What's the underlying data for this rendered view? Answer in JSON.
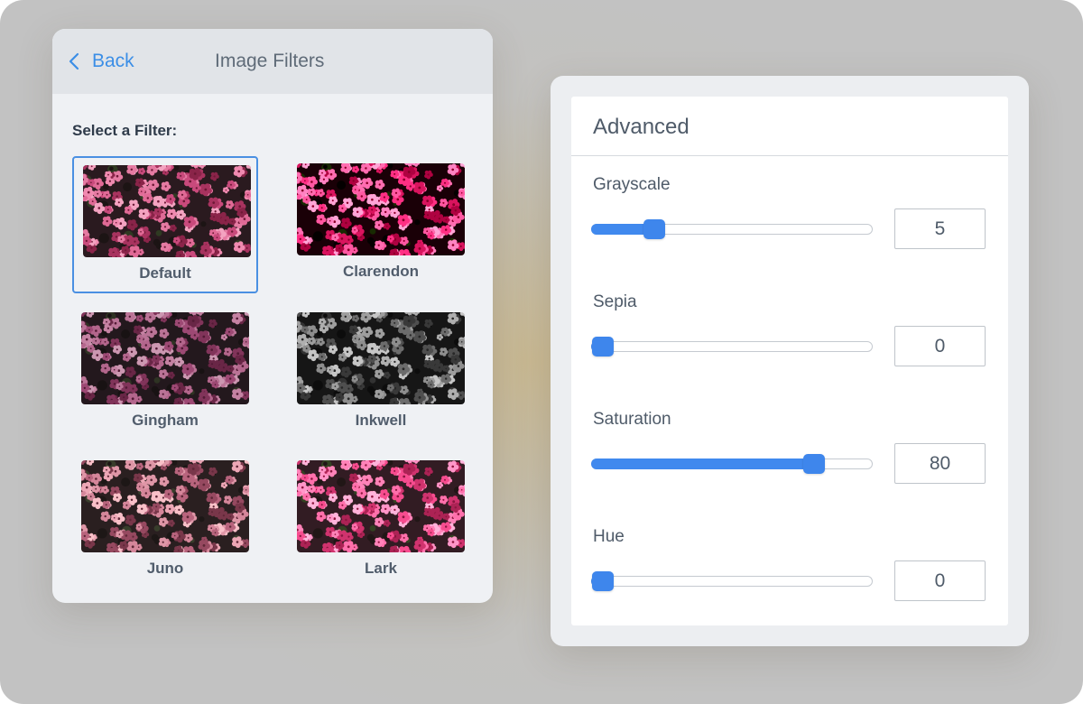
{
  "left_panel": {
    "back_label": "Back",
    "title": "Image Filters",
    "select_label": "Select a Filter:",
    "filters": [
      {
        "label": "Default",
        "selected": true
      },
      {
        "label": "Clarendon",
        "selected": false
      },
      {
        "label": "Gingham",
        "selected": false
      },
      {
        "label": "Inkwell",
        "selected": false
      },
      {
        "label": "Juno",
        "selected": false
      },
      {
        "label": "Lark",
        "selected": false
      }
    ]
  },
  "right_panel": {
    "title": "Advanced",
    "controls": [
      {
        "label": "Grayscale",
        "value": "5",
        "fraction": 0.22
      },
      {
        "label": "Sepia",
        "value": "0",
        "fraction": 0.04
      },
      {
        "label": "Saturation",
        "value": "80",
        "fraction": 0.79
      },
      {
        "label": "Hue",
        "value": "0",
        "fraction": 0.04
      }
    ]
  },
  "colors": {
    "accent": "#4089ee",
    "link": "#3b8ee6",
    "selected_border": "#4a90e2"
  },
  "icons": {
    "back": "chevron-left-icon"
  }
}
